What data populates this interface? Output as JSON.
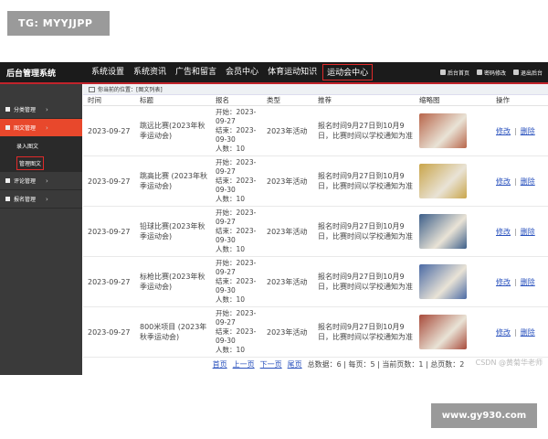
{
  "watermark_top": "TG: MYYJJPP",
  "watermark_bottom": "www.gy930.com",
  "header": {
    "brand": "后台管理系统",
    "nav": [
      "系统设置",
      "系统资讯",
      "广告和留言",
      "会员中心",
      "体育运动知识",
      "运动会中心"
    ],
    "active_nav": "运动会中心",
    "utils": [
      "后台首页",
      "密码修改",
      "退出后台"
    ]
  },
  "sidebar": {
    "groups": [
      {
        "label": "分类管理",
        "active": false
      },
      {
        "label": "图文管理",
        "active": true
      }
    ],
    "subs": [
      {
        "label": "录入图文",
        "selected": false
      },
      {
        "label": "管理图文",
        "selected": true
      }
    ],
    "groups_after": [
      {
        "label": "评论管理"
      },
      {
        "label": "报名管理"
      }
    ]
  },
  "breadcrumb": {
    "prefix": "你当前的位置：",
    "path": "[图文列表]"
  },
  "table": {
    "columns": [
      "时间",
      "标题",
      "报名",
      "类型",
      "推荐",
      "缩略图",
      "操作"
    ],
    "rows": [
      {
        "time": "2023-09-27",
        "title": "跳远比赛(2023年秋季运动会)",
        "reg": [
          "开始：2023-",
          "09-27",
          "结束：2023-",
          "09-30",
          "人数：10"
        ],
        "type": "2023年活动",
        "rec": "报名时间9月27日到10月9日，比赛时间以学校通知为准",
        "thumb_color": "#b8654a",
        "edit": "修改",
        "del": "删除"
      },
      {
        "time": "2023-09-27",
        "title": "跳高比赛 (2023年秋季运动会)",
        "reg": [
          "开始：2023-",
          "09-27",
          "结束：2023-",
          "09-30",
          "人数：10"
        ],
        "type": "2023年活动",
        "rec": "报名时间9月27日到10月9日，比赛时间以学校通知为准",
        "thumb_color": "#c9a54a",
        "edit": "修改",
        "del": "删除"
      },
      {
        "time": "2023-09-27",
        "title": "铅球比赛(2023年秋季运动会)",
        "reg": [
          "开始：2023-",
          "09-27",
          "结束：2023-",
          "09-30",
          "人数：10"
        ],
        "type": "2023年活动",
        "rec": "报名时间9月27日到10月9日，比赛时间以学校通知为准",
        "thumb_color": "#3d5f8a",
        "edit": "修改",
        "del": "删除"
      },
      {
        "time": "2023-09-27",
        "title": "标枪比赛(2023年秋季运动会)",
        "reg": [
          "开始：2023-",
          "09-27",
          "结束：2023-",
          "09-30",
          "人数：10"
        ],
        "type": "2023年活动",
        "rec": "报名时间9月27日到10月9日，比赛时间以学校通知为准",
        "thumb_color": "#4a6aa5",
        "edit": "修改",
        "del": "删除"
      },
      {
        "time": "2023-09-27",
        "title": "800米项目 (2023年秋季运动会)",
        "reg": [
          "开始：2023-",
          "09-27",
          "结束：2023-",
          "09-30",
          "人数：10"
        ],
        "type": "2023年活动",
        "rec": "报名时间9月27日到10月9日，比赛时间以学校通知为准",
        "thumb_color": "#a84a3a",
        "edit": "修改",
        "del": "删除"
      }
    ]
  },
  "pager": {
    "first": "首页",
    "prev": "上一页",
    "next": "下一页",
    "last": "尾页",
    "summary": "总数据：6 | 每页：5 | 当前页数：1 | 总页数：2"
  },
  "csdn": "CSDN @黄菊华老师"
}
